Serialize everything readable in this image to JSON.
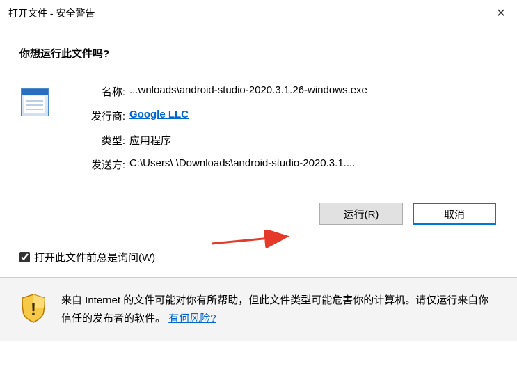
{
  "titlebar": {
    "title": "打开文件 - 安全警告"
  },
  "question": "你想运行此文件吗?",
  "labels": {
    "name": "名称:",
    "publisher": "发行商:",
    "type": "类型:",
    "from": "发送方:"
  },
  "values": {
    "name": "...wnloads\\android-studio-2020.3.1.26-windows.exe",
    "publisher": "Google LLC",
    "type": "应用程序",
    "from": "C:\\Users\\      \\Downloads\\android-studio-2020.3.1...."
  },
  "buttons": {
    "run": "运行(R)",
    "cancel": "取消"
  },
  "checkbox": {
    "label": "打开此文件前总是询问(W)",
    "checked": true
  },
  "footer": {
    "text": "来自 Internet 的文件可能对你有所帮助，但此文件类型可能危害你的计算机。请仅运行来自你信任的发布者的软件。",
    "link": "有何风险?"
  }
}
